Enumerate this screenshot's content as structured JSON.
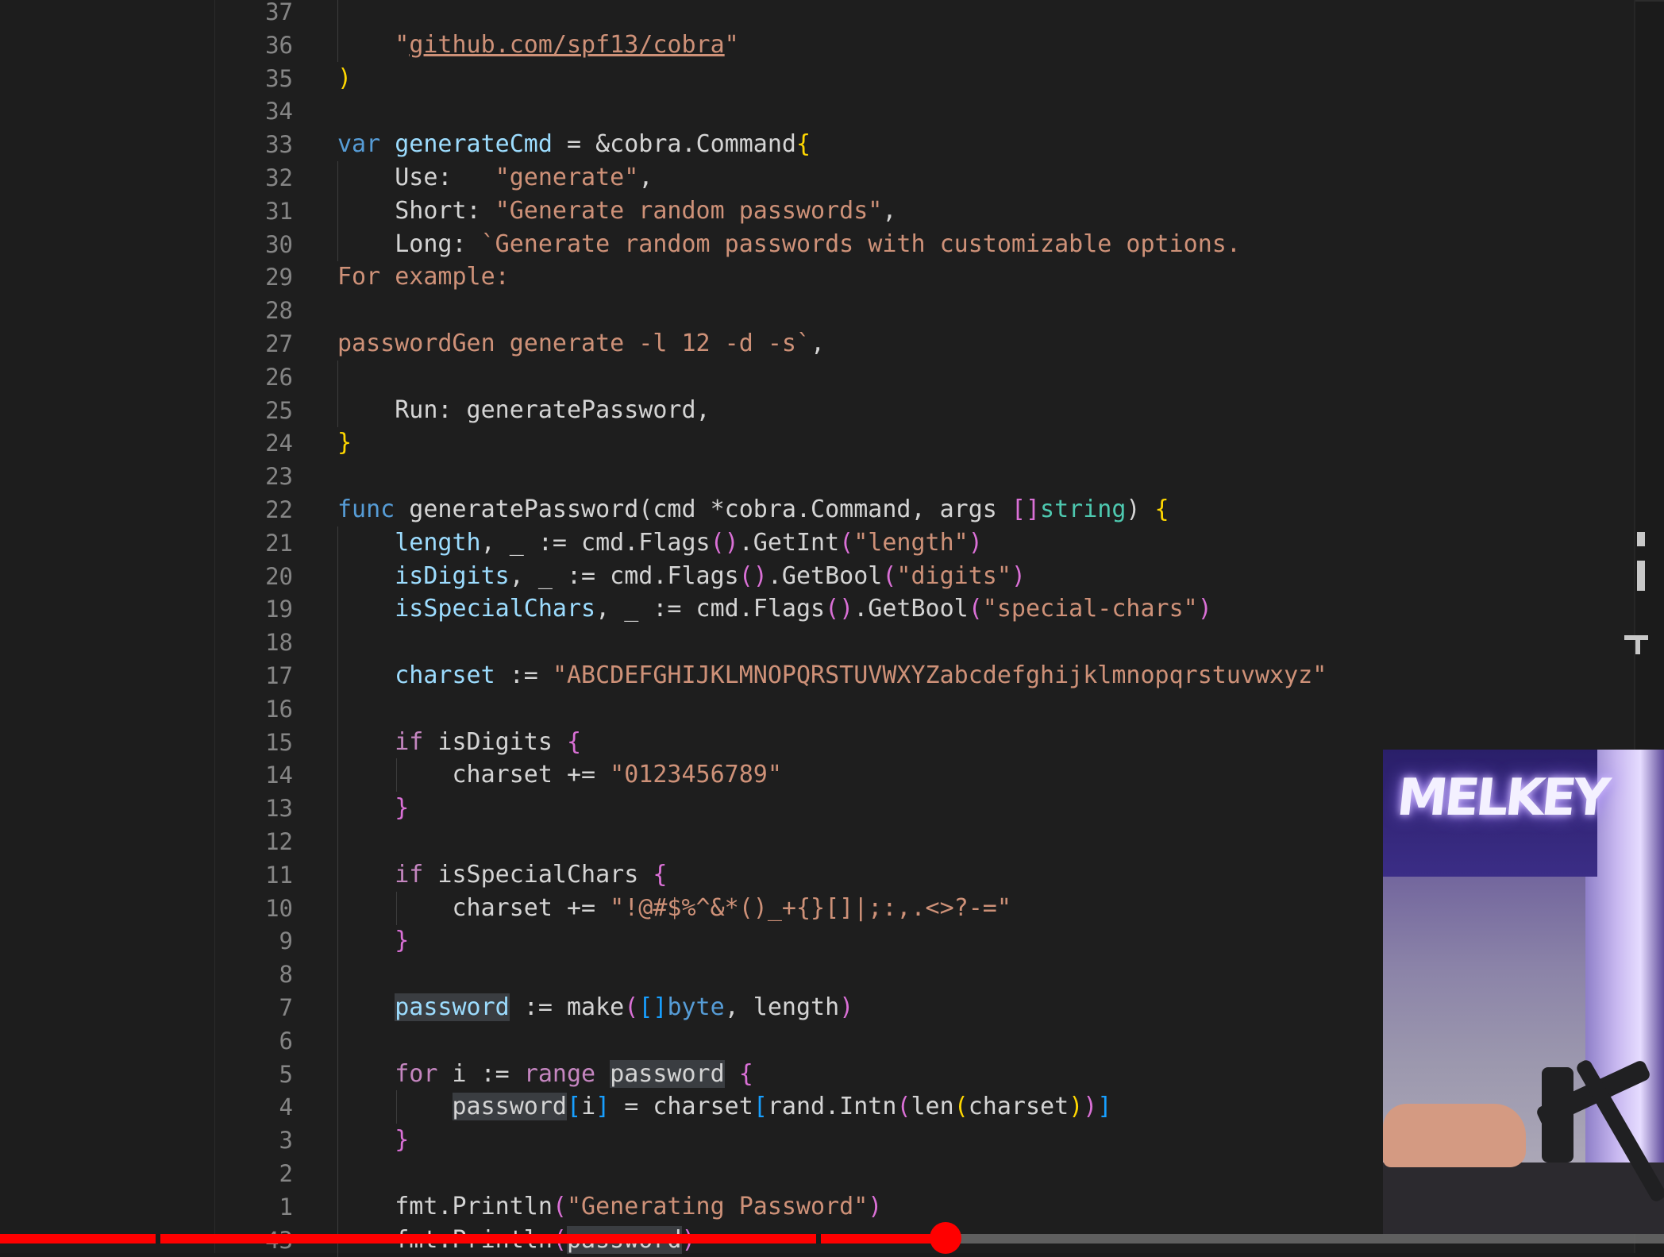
{
  "editor": {
    "lines": [
      {
        "num": "37",
        "partial": true,
        "guides": [
          1
        ],
        "tokens": []
      },
      {
        "num": "36",
        "guides": [
          1
        ],
        "tokens": [
          {
            "t": "    "
          },
          {
            "t": "\"",
            "c": "str"
          },
          {
            "t": "github.com/spf13/cobra",
            "c": "str link"
          },
          {
            "t": "\"",
            "c": "str"
          }
        ]
      },
      {
        "num": "35",
        "tokens": [
          {
            "t": ")",
            "c": "br1"
          }
        ]
      },
      {
        "num": "34",
        "tokens": []
      },
      {
        "num": "33",
        "tokens": [
          {
            "t": "var",
            "c": "kwb"
          },
          {
            "t": " "
          },
          {
            "t": "generateCmd",
            "c": "var"
          },
          {
            "t": " = &cobra."
          },
          {
            "t": "Command",
            "c": "typ-plain"
          },
          {
            "t": "{",
            "c": "br1"
          }
        ]
      },
      {
        "num": "32",
        "guides": [
          1
        ],
        "tokens": [
          {
            "t": "    Use:   "
          },
          {
            "t": "\"generate\"",
            "c": "str"
          },
          {
            "t": ","
          }
        ]
      },
      {
        "num": "31",
        "guides": [
          1
        ],
        "tokens": [
          {
            "t": "    Short: "
          },
          {
            "t": "\"Generate random passwords\"",
            "c": "str"
          },
          {
            "t": ","
          }
        ]
      },
      {
        "num": "30",
        "guides": [
          1
        ],
        "tokens": [
          {
            "t": "    Long: "
          },
          {
            "t": "`Generate random passwords with customizable options.",
            "c": "str"
          }
        ]
      },
      {
        "num": "29",
        "tokens": [
          {
            "t": "For example:",
            "c": "str"
          }
        ]
      },
      {
        "num": "28",
        "tokens": []
      },
      {
        "num": "27",
        "tokens": [
          {
            "t": "passwordGen generate -l 12 -d -s`",
            "c": "str"
          },
          {
            "t": ","
          }
        ]
      },
      {
        "num": "26",
        "guides": [
          1
        ],
        "tokens": []
      },
      {
        "num": "25",
        "guides": [
          1
        ],
        "tokens": [
          {
            "t": "    Run: generatePassword,"
          }
        ]
      },
      {
        "num": "24",
        "tokens": [
          {
            "t": "}",
            "c": "br1"
          }
        ]
      },
      {
        "num": "23",
        "tokens": []
      },
      {
        "num": "22",
        "tokens": [
          {
            "t": "func",
            "c": "kwb"
          },
          {
            "t": " generatePassword"
          },
          {
            "t": "("
          },
          {
            "t": "cmd *cobra.Command, args "
          },
          {
            "t": "[]",
            "c": "br2"
          },
          {
            "t": "string",
            "c": "typ"
          },
          {
            "t": ")"
          },
          {
            "t": " "
          },
          {
            "t": "{",
            "c": "br1"
          }
        ]
      },
      {
        "num": "21",
        "guides": [
          1
        ],
        "tokens": [
          {
            "t": "    "
          },
          {
            "t": "length",
            "c": "var"
          },
          {
            "t": ", _ := cmd.Flags"
          },
          {
            "t": "()",
            "c": "br2"
          },
          {
            "t": ".GetInt"
          },
          {
            "t": "(",
            "c": "br2"
          },
          {
            "t": "\"length\"",
            "c": "str"
          },
          {
            "t": ")",
            "c": "br2"
          }
        ]
      },
      {
        "num": "20",
        "guides": [
          1
        ],
        "tokens": [
          {
            "t": "    "
          },
          {
            "t": "isDigits",
            "c": "var"
          },
          {
            "t": ", _ := cmd.Flags"
          },
          {
            "t": "()",
            "c": "br2"
          },
          {
            "t": ".GetBool"
          },
          {
            "t": "(",
            "c": "br2"
          },
          {
            "t": "\"digits\"",
            "c": "str"
          },
          {
            "t": ")",
            "c": "br2"
          }
        ]
      },
      {
        "num": "19",
        "guides": [
          1
        ],
        "tokens": [
          {
            "t": "    "
          },
          {
            "t": "isSpecialChars",
            "c": "var"
          },
          {
            "t": ", _ := cmd.Flags"
          },
          {
            "t": "()",
            "c": "br2"
          },
          {
            "t": ".GetBool"
          },
          {
            "t": "(",
            "c": "br2"
          },
          {
            "t": "\"special-chars\"",
            "c": "str"
          },
          {
            "t": ")",
            "c": "br2"
          }
        ]
      },
      {
        "num": "18",
        "guides": [
          1
        ],
        "tokens": []
      },
      {
        "num": "17",
        "guides": [
          1
        ],
        "tokens": [
          {
            "t": "    "
          },
          {
            "t": "charset",
            "c": "var"
          },
          {
            "t": " := "
          },
          {
            "t": "\"ABCDEFGHIJKLMNOPQRSTUVWXYZabcdefghijklmnopqrstuvwxyz\"",
            "c": "str"
          }
        ]
      },
      {
        "num": "16",
        "guides": [
          1
        ],
        "tokens": []
      },
      {
        "num": "15",
        "guides": [
          1
        ],
        "tokens": [
          {
            "t": "    "
          },
          {
            "t": "if",
            "c": "kw"
          },
          {
            "t": " isDigits "
          },
          {
            "t": "{",
            "c": "br2"
          }
        ]
      },
      {
        "num": "14",
        "guides": [
          1,
          2
        ],
        "tokens": [
          {
            "t": "        charset += "
          },
          {
            "t": "\"0123456789\"",
            "c": "str"
          }
        ]
      },
      {
        "num": "13",
        "guides": [
          1
        ],
        "tokens": [
          {
            "t": "    "
          },
          {
            "t": "}",
            "c": "br2"
          }
        ]
      },
      {
        "num": "12",
        "guides": [
          1
        ],
        "tokens": []
      },
      {
        "num": "11",
        "guides": [
          1
        ],
        "tokens": [
          {
            "t": "    "
          },
          {
            "t": "if",
            "c": "kw"
          },
          {
            "t": " isSpecialChars "
          },
          {
            "t": "{",
            "c": "br2"
          }
        ]
      },
      {
        "num": "10",
        "guides": [
          1,
          2
        ],
        "tokens": [
          {
            "t": "        charset += "
          },
          {
            "t": "\"!@#$%^&*()_+{}[]|;:,.<>?-=\"",
            "c": "str"
          }
        ]
      },
      {
        "num": "9",
        "guides": [
          1
        ],
        "tokens": [
          {
            "t": "    "
          },
          {
            "t": "}",
            "c": "br2"
          }
        ]
      },
      {
        "num": "8",
        "guides": [
          1
        ],
        "tokens": []
      },
      {
        "num": "7",
        "guides": [
          1
        ],
        "tokens": [
          {
            "t": "    "
          },
          {
            "t": "password",
            "c": "var hl"
          },
          {
            "t": " := make"
          },
          {
            "t": "(",
            "c": "br2"
          },
          {
            "t": "[]",
            "c": "br3"
          },
          {
            "t": "byte",
            "c": "kwb"
          },
          {
            "t": ", length"
          },
          {
            "t": ")",
            "c": "br2"
          }
        ]
      },
      {
        "num": "6",
        "guides": [
          1
        ],
        "tokens": []
      },
      {
        "num": "5",
        "guides": [
          1
        ],
        "tokens": [
          {
            "t": "    "
          },
          {
            "t": "for",
            "c": "kw"
          },
          {
            "t": " i := "
          },
          {
            "t": "range",
            "c": "kw"
          },
          {
            "t": " "
          },
          {
            "t": "password",
            "c": "hl"
          },
          {
            "t": " "
          },
          {
            "t": "{",
            "c": "br2"
          }
        ]
      },
      {
        "num": "4",
        "guides": [
          1,
          2
        ],
        "tokens": [
          {
            "t": "        "
          },
          {
            "t": "password",
            "c": "hl"
          },
          {
            "t": "[",
            "c": "br3"
          },
          {
            "t": "i"
          },
          {
            "t": "]",
            "c": "br3"
          },
          {
            "t": " = charset"
          },
          {
            "t": "[",
            "c": "br3"
          },
          {
            "t": "rand.Intn"
          },
          {
            "t": "(",
            "c": "br2"
          },
          {
            "t": "len"
          },
          {
            "t": "(",
            "c": "br1"
          },
          {
            "t": "charset"
          },
          {
            "t": ")",
            "c": "br1"
          },
          {
            "t": ")",
            "c": "br2"
          },
          {
            "t": "]",
            "c": "br3"
          }
        ]
      },
      {
        "num": "3",
        "guides": [
          1
        ],
        "tokens": [
          {
            "t": "    "
          },
          {
            "t": "}",
            "c": "br2"
          }
        ]
      },
      {
        "num": "2",
        "guides": [
          1
        ],
        "tokens": []
      },
      {
        "num": "1",
        "guides": [
          1
        ],
        "tokens": [
          {
            "t": "    fmt.Println"
          },
          {
            "t": "(",
            "c": "br2"
          },
          {
            "t": "\"Generating Password\"",
            "c": "str"
          },
          {
            "t": ")",
            "c": "br2"
          }
        ]
      },
      {
        "num": "43",
        "partial": true,
        "guides": [
          1
        ],
        "tokens": [
          {
            "t": "    fmt.Println"
          },
          {
            "t": "(",
            "c": "br2"
          },
          {
            "t": "password",
            "c": "hl"
          },
          {
            "t": ")",
            "c": "br2"
          }
        ]
      }
    ]
  },
  "webcam": {
    "sign_text": "MELKEY"
  },
  "video": {
    "progress_fraction": 0.568
  },
  "colors": {
    "background": "#1e1e1e",
    "progress": "#ff0000"
  }
}
